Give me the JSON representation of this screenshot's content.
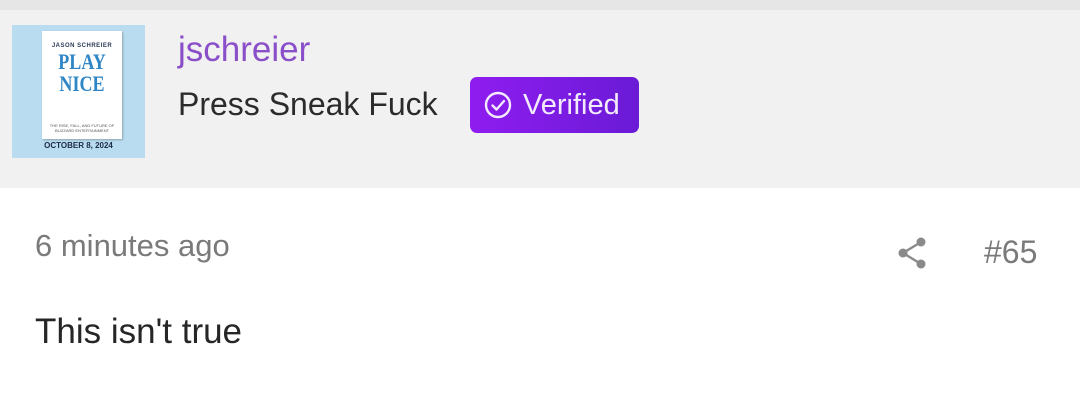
{
  "post": {
    "avatar": {
      "book_author": "JASON SCHREIER",
      "book_title_line1": "PLAY",
      "book_title_line2": "NICE",
      "book_subtitle": "THE RISE, FALL, AND FUTURE OF BLIZZARD ENTERTAINMENT",
      "book_date": "OCTOBER 8, 2024"
    },
    "username": "jschreier",
    "user_title": "Press Sneak Fuck",
    "badge": {
      "label": "Verified",
      "icon": "check-circle-icon"
    },
    "timestamp": "6 minutes ago",
    "share_icon": "share-icon",
    "number": "#65",
    "body": "This isn't true"
  },
  "colors": {
    "header_bg": "#f1f1f2",
    "username": "#8a4ec8",
    "badge_start": "#8f1cf0",
    "badge_end": "#6a1bd6",
    "meta_text": "#7a7a7a"
  }
}
